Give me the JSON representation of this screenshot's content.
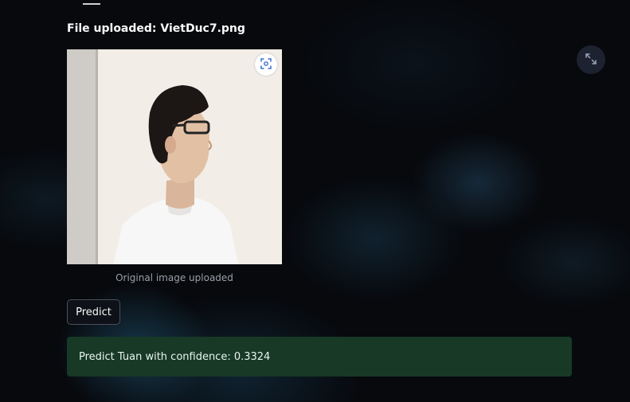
{
  "file": {
    "uploaded_text": "File uploaded: VietDuc7.png"
  },
  "image": {
    "caption": "Original image uploaded"
  },
  "actions": {
    "predict_label": "Predict"
  },
  "result": {
    "message": "Predict Tuan with confidence: 0.3324"
  },
  "icons": {
    "expand": "expand-icon",
    "fullscreen": "fullscreen-icon"
  },
  "colors": {
    "background": "#07090d",
    "success_bg": "#173926",
    "button_border": "#4a4f5a"
  }
}
